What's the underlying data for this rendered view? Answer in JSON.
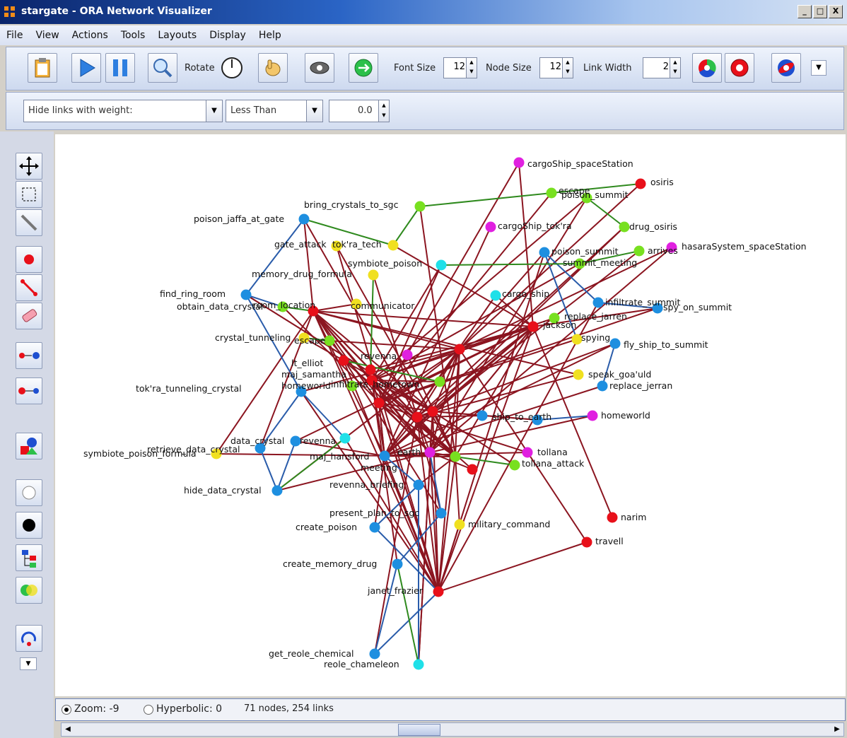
{
  "window": {
    "title": "stargate - ORA Network Visualizer",
    "minimize": "_",
    "maximize": "□",
    "close": "X"
  },
  "menu": [
    "File",
    "View",
    "Actions",
    "Tools",
    "Layouts",
    "Display",
    "Help"
  ],
  "toolbar": {
    "rotate_label": "Rotate",
    "font_size_label": "Font Size",
    "font_size_value": "12",
    "node_size_label": "Node Size",
    "node_size_value": "12",
    "link_width_label": "Link Width",
    "link_width_value": "2"
  },
  "filter": {
    "hide_links": "Hide links with weight:",
    "operator": "Less Than",
    "threshold": "0.0"
  },
  "status": {
    "zoom": "Zoom: -9",
    "hyperbolic": "Hyperbolic: 0",
    "counts": "71 nodes, 254 links"
  },
  "colors": {
    "agent": "#e8101a",
    "task": "#1e8fe0",
    "resource": "#78e020",
    "knowledge": "#f0e020",
    "location": "#e020e0",
    "event": "#20e0e8"
  },
  "graph": {
    "nodes": [
      {
        "id": "cargoShip_spaceStation",
        "color": "location"
      },
      {
        "id": "osiris",
        "color": "agent"
      },
      {
        "id": "poison_summit",
        "color": "resource"
      },
      {
        "id": "escape",
        "color": "resource"
      },
      {
        "id": "drug_osiris",
        "color": "resource"
      },
      {
        "id": "arrives",
        "color": "resource"
      },
      {
        "id": "hasaraSystem_spaceStation",
        "color": "location"
      },
      {
        "id": "bring_crystals_to_sgc",
        "color": "resource"
      },
      {
        "id": "poison_jaffa_at_gate",
        "color": "task"
      },
      {
        "id": "cargoShip_tok'ra",
        "color": "location"
      },
      {
        "id": "gate_attack",
        "color": "knowledge"
      },
      {
        "id": "tok'ra_tech",
        "color": "knowledge"
      },
      {
        "id": "poison_summit_2",
        "color": "task"
      },
      {
        "id": "summit_meeting",
        "color": "resource"
      },
      {
        "id": "symbiote_poison",
        "color": "event"
      },
      {
        "id": "memory_drug_formula",
        "color": "knowledge"
      },
      {
        "id": "find_ring_room",
        "color": "task"
      },
      {
        "id": "obtain_data_crystal",
        "color": "resource"
      },
      {
        "id": "room_location",
        "color": "agent"
      },
      {
        "id": "communicator",
        "color": "knowledge"
      },
      {
        "id": "cargo_ship",
        "color": "event"
      },
      {
        "id": "infiltrate_summit",
        "color": "task"
      },
      {
        "id": "spy_on_summit",
        "color": "task"
      },
      {
        "id": "replace_jarren",
        "color": "resource"
      },
      {
        "id": "jackson",
        "color": "agent"
      },
      {
        "id": "spying",
        "color": "knowledge"
      },
      {
        "id": "fly_ship_to_summit",
        "color": "task"
      },
      {
        "id": "crystal_tunneling",
        "color": "knowledge"
      },
      {
        "id": "escape_2",
        "color": "resource"
      },
      {
        "id": "revenna",
        "color": "location"
      },
      {
        "id": "speak_goa'uld",
        "color": "knowledge"
      },
      {
        "id": "replace_jerran",
        "color": "task"
      },
      {
        "id": "lt_elliot",
        "color": "agent"
      },
      {
        "id": "maj_samantha",
        "color": "agent"
      },
      {
        "id": "tok'ra_tunneling_crystal",
        "color": "task"
      },
      {
        "id": "homeworld",
        "color": "resource"
      },
      {
        "id": "hub_green",
        "color": "resource"
      },
      {
        "id": "infiltrate_hometown",
        "color": "task"
      },
      {
        "id": "ship_to_earth",
        "color": "task"
      },
      {
        "id": "homeworld_loc",
        "color": "location"
      },
      {
        "id": "symbiote_poison_formula",
        "color": "knowledge"
      },
      {
        "id": "retrieve_data_crystal",
        "color": "task"
      },
      {
        "id": "data_crystal",
        "color": "task"
      },
      {
        "id": "revenna_2",
        "color": "event"
      },
      {
        "id": "maj_hansford",
        "color": "task"
      },
      {
        "id": "earth",
        "color": "location"
      },
      {
        "id": "earth_agent",
        "color": "agent"
      },
      {
        "id": "meeting",
        "color": "resource"
      },
      {
        "id": "tollana",
        "color": "location"
      },
      {
        "id": "tollana_attack",
        "color": "resource"
      },
      {
        "id": "hide_data_crystal",
        "color": "task"
      },
      {
        "id": "revenna_briefing",
        "color": "task"
      },
      {
        "id": "present_plan_to_sgc",
        "color": "task"
      },
      {
        "id": "create_poison",
        "color": "task"
      },
      {
        "id": "military_command",
        "color": "knowledge"
      },
      {
        "id": "narim",
        "color": "agent"
      },
      {
        "id": "travell",
        "color": "agent"
      },
      {
        "id": "create_memory_drug",
        "color": "task"
      },
      {
        "id": "janet_frazier",
        "color": "agent"
      },
      {
        "id": "get_reole_chemical",
        "color": "task"
      },
      {
        "id": "reole_chameleon",
        "color": "event"
      }
    ],
    "labels": [
      "cargoShip_spaceStation",
      "osiris",
      "poison_summit",
      "escape",
      "drug_osiris",
      "arrives",
      "hasaraSystem_spaceStation",
      "bring_crystals_to_sgc",
      "poison_jaffa_at_gate",
      "cargoShip_tok'ra",
      "gate_attack",
      "tok'ra_tech",
      "poison_summit",
      "summit_meeting",
      "symbiote_poison",
      "memory_drug_formula",
      "find_ring_room",
      "obtain_data_crystal",
      "room_location",
      "communicator",
      "cargo_ship",
      "infiltrate_summit",
      "spy_on_summit",
      "replace_jarren",
      "jackson",
      "spying",
      "fly_ship_to_summit",
      "crystal_tunneling",
      "escape",
      "revenna",
      "speak_goa'uld",
      "replace_jerran",
      "lt_elliot",
      "maj_samantha",
      "tok'ra_tunneling_crystal",
      "homeworld",
      "infiltrate_hometown",
      "ship_to_earth",
      "homeworld",
      "symbiote_poison_formula",
      "retrieve_data_crystal",
      "data_crystal",
      "revenna",
      "maj_hansford",
      "earth",
      "meeting",
      "tollana",
      "tollana_attack",
      "hide_data_crystal",
      "revenna_briefing",
      "present_plan_to_sgc",
      "create_poison",
      "military_command",
      "narim",
      "travell",
      "create_memory_drug",
      "janet_frazier",
      "get_reole_chemical",
      "reole_chameleon"
    ]
  }
}
